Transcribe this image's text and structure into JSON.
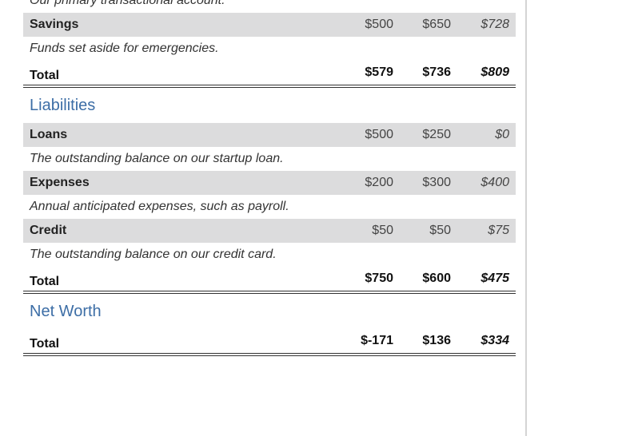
{
  "assets_tail": {
    "partial_description": "Our primary transactional account.",
    "savings": {
      "label": "Savings",
      "v1": "$500",
      "v2": "$650",
      "v3": "$728",
      "description": "Funds set aside for emergencies."
    },
    "total": {
      "label": "Total",
      "v1": "$579",
      "v2": "$736",
      "v3": "$809"
    }
  },
  "liabilities": {
    "heading": "Liabilities",
    "rows": [
      {
        "label": "Loans",
        "v1": "$500",
        "v2": "$250",
        "v3": "$0",
        "description": "The outstanding balance on our startup loan."
      },
      {
        "label": "Expenses",
        "v1": "$200",
        "v2": "$300",
        "v3": "$400",
        "description": "Annual anticipated expenses, such as payroll."
      },
      {
        "label": "Credit",
        "v1": "$50",
        "v2": "$50",
        "v3": "$75",
        "description": "The outstanding balance on our credit card."
      }
    ],
    "total": {
      "label": "Total",
      "v1": "$750",
      "v2": "$600",
      "v3": "$475"
    }
  },
  "net_worth": {
    "heading": "Net Worth",
    "total": {
      "label": "Total",
      "v1": "$-171",
      "v2": "$136",
      "v3": "$334"
    }
  },
  "colors": {
    "heading": "#3d6ea6",
    "row_band": "#dcdcdd"
  }
}
